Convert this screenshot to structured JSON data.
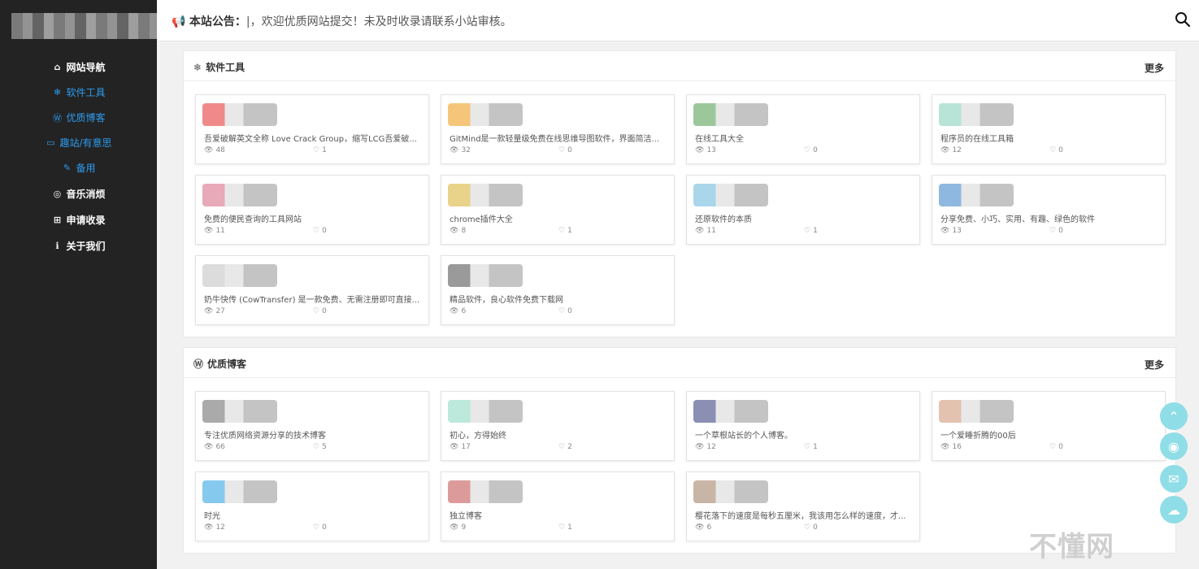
{
  "sidebar": {
    "items": [
      {
        "label": "网站导航",
        "icon": "⌂",
        "icon_name": "home-icon",
        "sub": false
      },
      {
        "label": "软件工具",
        "icon": "❄",
        "icon_name": "snowflake-icon",
        "sub": true
      },
      {
        "label": "优质博客",
        "icon": "Ⓦ",
        "icon_name": "wordpress-icon",
        "sub": true
      },
      {
        "label": "趣站/有意思",
        "icon": "▭",
        "icon_name": "monitor-icon",
        "sub": true
      },
      {
        "label": "备用",
        "icon": "✎",
        "icon_name": "pencil-icon",
        "sub": true
      },
      {
        "label": "音乐消烦",
        "icon": "◎",
        "icon_name": "gamepad-icon",
        "sub": false
      },
      {
        "label": "申请收录",
        "icon": "⊞",
        "icon_name": "plus-square-icon",
        "sub": false
      },
      {
        "label": "关于我们",
        "icon": "ℹ",
        "icon_name": "info-icon",
        "sub": false
      }
    ]
  },
  "topbar": {
    "notice_label": "本站公告：",
    "notice_text": "|，欢迎优质网站提交！未及时收录请联系小站审核。"
  },
  "sections": [
    {
      "title": "软件工具",
      "icon": "❄",
      "more": "更多",
      "cards": [
        {
          "desc": "吾爱破解英文全称 Love Crack Group，缩写LCG吾爱破...",
          "views": "48",
          "likes": "1",
          "color": "#f08a8a"
        },
        {
          "desc": "GitMind是一款轻量级免费在线思维导图软件，界面简洁...",
          "views": "32",
          "likes": "0",
          "color": "#f5c67a"
        },
        {
          "desc": "在线工具大全",
          "views": "13",
          "likes": "0",
          "color": "#9cc79b"
        },
        {
          "desc": "程序员的在线工具箱",
          "views": "12",
          "likes": "0",
          "color": "#b7e4d7"
        },
        {
          "desc": "免费的便民查询的工具网站",
          "views": "11",
          "likes": "0",
          "color": "#e8a9b8"
        },
        {
          "desc": "chrome插件大全",
          "views": "8",
          "likes": "1",
          "color": "#e9d28a"
        },
        {
          "desc": "还原软件的本质",
          "views": "11",
          "likes": "1",
          "color": "#a9d6ea"
        },
        {
          "desc": "分享免费、小巧、实用、有趣、绿色的软件",
          "views": "13",
          "likes": "0",
          "color": "#8fb8e0"
        },
        {
          "desc": "奶牛快传 (CowTransfer) 是一款免费、无需注册即可直接...",
          "views": "27",
          "likes": "0",
          "color": "#dcdcdc"
        },
        {
          "desc": "精品软件，良心软件免费下载网",
          "views": "6",
          "likes": "0",
          "color": "#9a9a9a"
        }
      ]
    },
    {
      "title": "优质博客",
      "icon": "Ⓦ",
      "more": "更多",
      "cards": [
        {
          "desc": "专注优质网络资源分享的技术博客",
          "views": "66",
          "likes": "5",
          "color": "#aaaaaa"
        },
        {
          "desc": "初心，方得始终",
          "views": "17",
          "likes": "2",
          "color": "#bde8dc"
        },
        {
          "desc": "一个草根站长的个人博客。",
          "views": "12",
          "likes": "1",
          "color": "#8b8fb3"
        },
        {
          "desc": "一个爱睡折腾的00后",
          "views": "16",
          "likes": "0",
          "color": "#e4c2b0"
        },
        {
          "desc": "时光",
          "views": "12",
          "likes": "0",
          "color": "#86c9ee"
        },
        {
          "desc": "独立博客",
          "views": "9",
          "likes": "1",
          "color": "#dd9a9a"
        },
        {
          "desc": "樱花落下的速度是每秒五厘米，我该用怎么样的速度，才...",
          "views": "6",
          "likes": "0",
          "color": "#c9b5a6"
        }
      ]
    }
  ],
  "floating": [
    {
      "icon": "⌃",
      "name": "back-to-top-icon"
    },
    {
      "icon": "◉",
      "name": "qq-icon"
    },
    {
      "icon": "✉",
      "name": "mail-icon"
    },
    {
      "icon": "☁",
      "name": "wechat-icon"
    }
  ],
  "watermark": "不懂网",
  "colors": {
    "sidebar": "#232323",
    "accent": "#2d9cf0",
    "float": "#8fdde6"
  }
}
